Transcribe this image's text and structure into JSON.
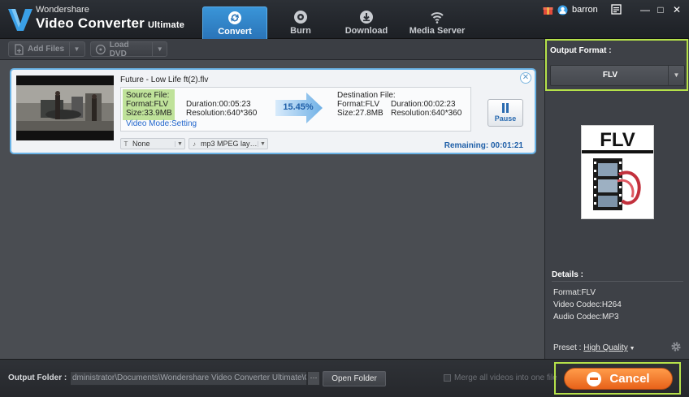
{
  "app": {
    "brand_small": "Wondershare",
    "brand_big": "Video Converter",
    "brand_edition": "Ultimate"
  },
  "tabs": [
    {
      "label": "Convert",
      "active": true
    },
    {
      "label": "Burn",
      "active": false
    },
    {
      "label": "Download",
      "active": false
    },
    {
      "label": "Media Server",
      "active": false
    }
  ],
  "user": {
    "name": "barron"
  },
  "window_controls": {
    "minimize": "—",
    "maximize": "□",
    "close": "✕"
  },
  "toolbar": {
    "add_files": "Add Files",
    "load_dvd": "Load DVD"
  },
  "item": {
    "filename": "Future - Low Life ft(2).flv",
    "source": {
      "title": "Source File:",
      "format": "Format:FLV",
      "size": "Size:33.9MB",
      "duration": "Duration:00:05:23",
      "resolution": "Resolution:640*360"
    },
    "video_mode": "Video Mode:Setting",
    "progress": "15.45%",
    "destination": {
      "title": "Destination File:",
      "format": "Format:FLV",
      "size": "Size:27.8MB",
      "duration": "Duration:00:02:23",
      "resolution": "Resolution:640*360"
    },
    "pause_label": "Pause",
    "subtitle_select": "None",
    "audio_select": "mp3 MPEG lay…",
    "remaining": "Remaining: 00:01:21"
  },
  "output_format": {
    "label": "Output Format :",
    "value": "FLV",
    "icon_text": "FLV"
  },
  "details": {
    "label": "Details :",
    "format": "Format:FLV",
    "video_codec": "Video Codec:H264",
    "audio_codec": "Audio Codec:MP3",
    "preset_label": "Preset :",
    "preset_value": "High Quality"
  },
  "bottom": {
    "output_folder_label": "Output Folder :",
    "output_path": "dministrator\\Documents\\Wondershare Video Converter Ultimate\\Output",
    "browse": "···",
    "open_folder": "Open Folder",
    "merge_label": "Merge all videos into one file",
    "cancel": "Cancel"
  },
  "colors": {
    "accent_blue": "#2a74b8",
    "highlight_green": "#b5e14a",
    "cancel_orange": "#e8621a",
    "source_green": "#bfe29a"
  }
}
